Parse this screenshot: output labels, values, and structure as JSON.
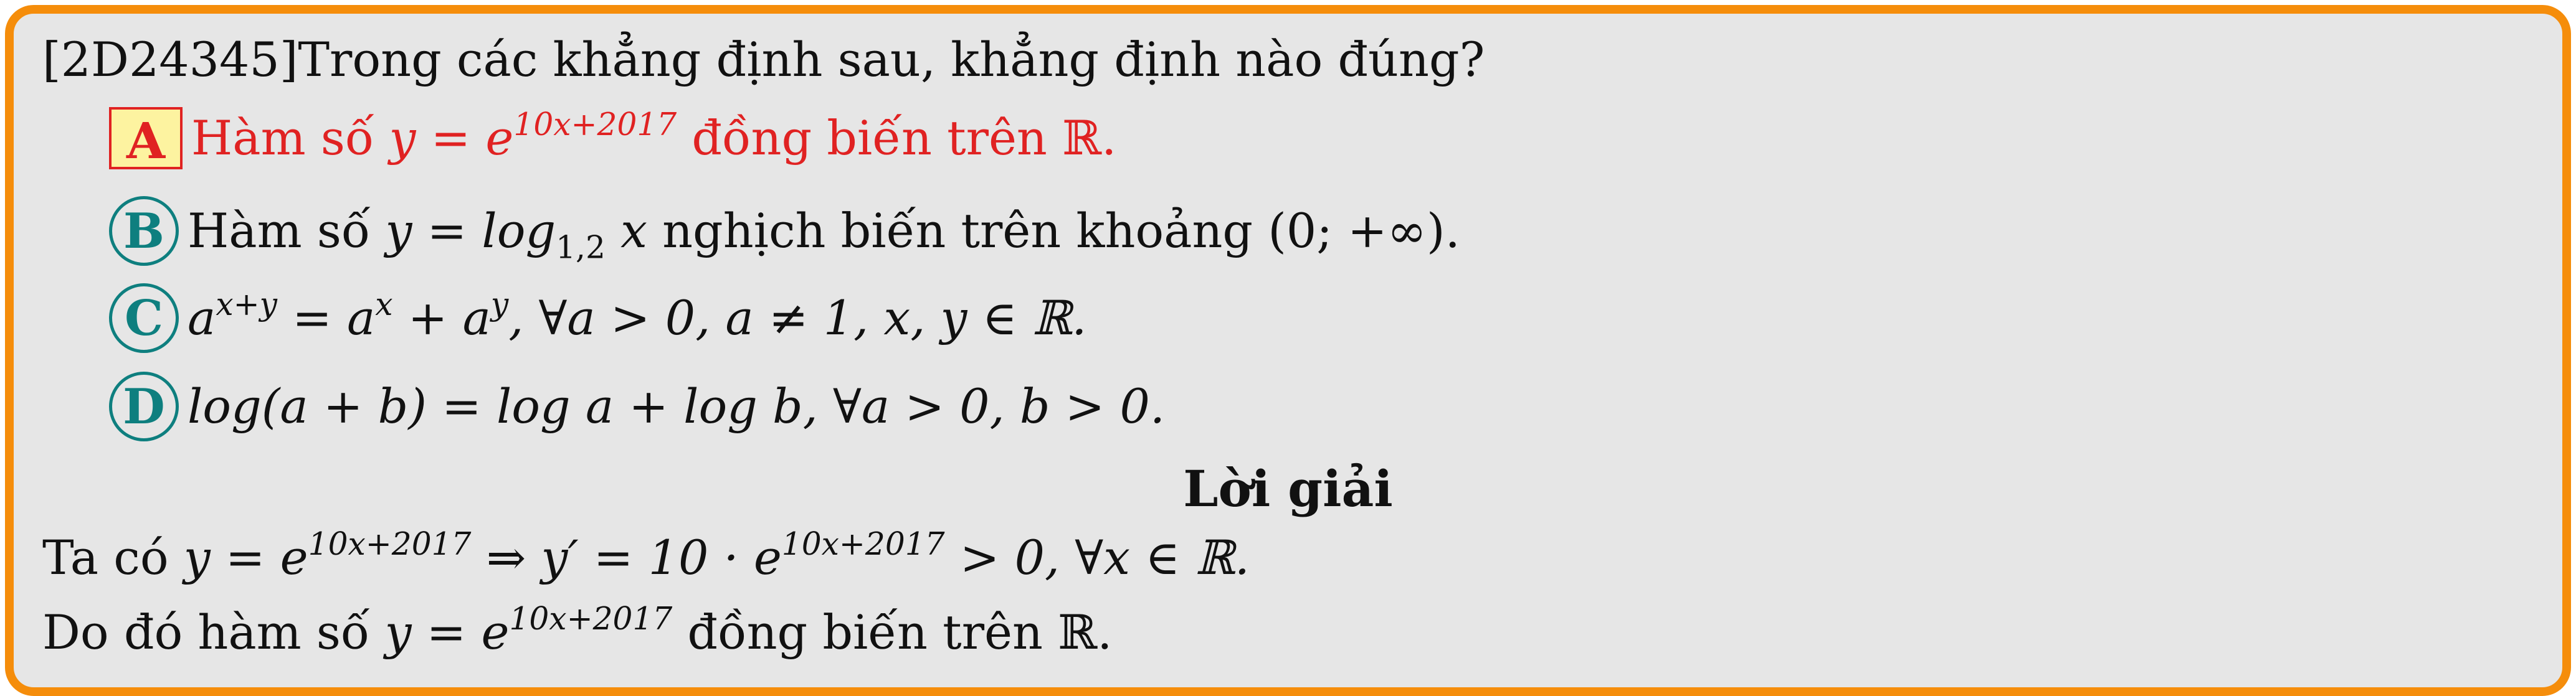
{
  "question": {
    "id": "[2D24345]",
    "prompt": "Trong các khẳng định sau, khẳng định nào đúng?"
  },
  "choices": [
    {
      "letter": "A",
      "correct": true,
      "text_before": "Hàm số ",
      "math": "y = e",
      "exponent": "10x+2017",
      "text_after": " đồng biến trên ℝ."
    },
    {
      "letter": "B",
      "correct": false,
      "text_before": "Hàm số ",
      "math": "y = log",
      "subscript": "1,2",
      "math_after": " x",
      "text_after": " nghịch biến trên khoảng (0; +∞)."
    },
    {
      "letter": "C",
      "correct": false,
      "base": "a",
      "exponent": "x+y",
      "rest": " = a",
      "exp2": "x",
      "rest2": " + a",
      "exp3": "y",
      "rest3": ",  ∀a > 0,  a ≠ 1,  x, y ∈ ℝ."
    },
    {
      "letter": "D",
      "correct": false,
      "text": "log(a + b) = log a + log b, ∀a > 0,  b > 0."
    }
  ],
  "solution": {
    "heading": "Lời giải",
    "line1": {
      "prefix": "Ta có ",
      "m1": "y = e",
      "e1": "10x+2017",
      "m2": " ⇒ y′ = 10 · e",
      "e2": "10x+2017",
      "suffix": " > 0,  ∀x ∈ ℝ."
    },
    "line2": {
      "prefix": "Do đó hàm số ",
      "m1": "y = e",
      "e1": "10x+2017",
      "suffix": " đồng biến trên ℝ."
    }
  },
  "colors": {
    "frame_border": "#f58d0b",
    "background": "#e6e6e6",
    "correct": "#e02222",
    "choice_circle": "#0e7f7f",
    "correct_badge_fill": "#fdf3a0"
  }
}
